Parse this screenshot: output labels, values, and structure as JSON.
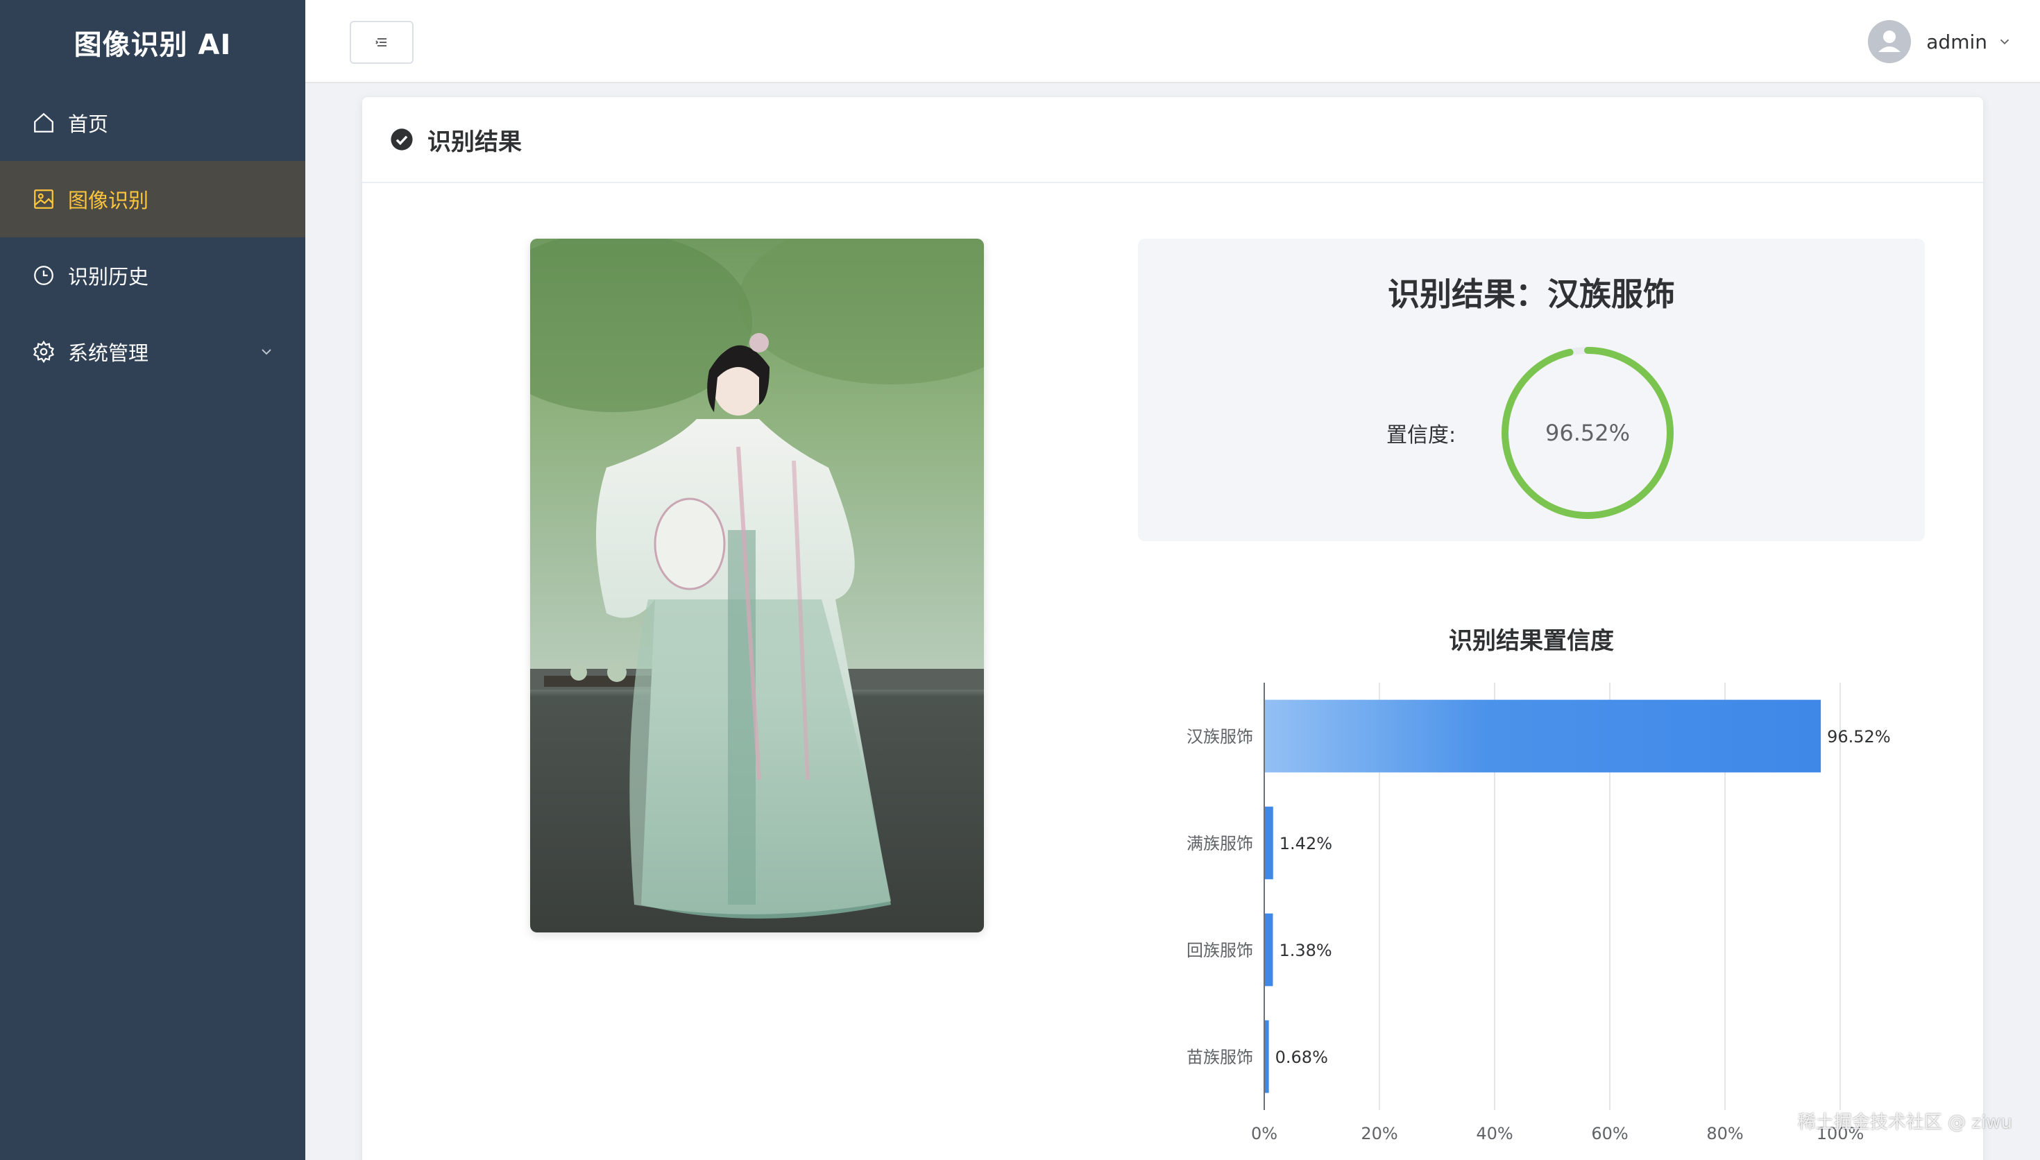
{
  "app": {
    "title": "图像识别 AI"
  },
  "sidebar": {
    "items": [
      {
        "label": "首页",
        "icon": "home-icon",
        "active": false
      },
      {
        "label": "图像识别",
        "icon": "picture-icon",
        "active": true
      },
      {
        "label": "识别历史",
        "icon": "clock-icon",
        "active": false
      },
      {
        "label": "系统管理",
        "icon": "gear-icon",
        "active": false,
        "expandable": true
      }
    ],
    "colors": {
      "background": "#304156",
      "active_background": "#4b4a44",
      "active_text": "#ffc53d"
    }
  },
  "header": {
    "toggle_icon": "menu-fold-icon",
    "user": {
      "name": "admin",
      "avatar_icon": "user-avatar-icon"
    }
  },
  "card": {
    "title": "识别结果",
    "title_icon": "check-circle-icon"
  },
  "image": {
    "alt": "hanfu photo"
  },
  "result": {
    "title": "识别结果：汉族服饰",
    "confidence_label": "置信度:",
    "confidence_text": "96.52%",
    "confidence_value": 96.52,
    "gauge_color": "#7ac44f"
  },
  "chart_title": "识别结果置信度",
  "chart_data": {
    "type": "bar",
    "orientation": "horizontal",
    "title": "识别结果置信度",
    "categories": [
      "汉族服饰",
      "满族服饰",
      "回族服饰",
      "苗族服饰"
    ],
    "values": [
      96.52,
      1.42,
      1.38,
      0.68
    ],
    "value_labels": [
      "96.52%",
      "1.42%",
      "1.38%",
      "0.68%"
    ],
    "xlim": [
      0,
      100
    ],
    "x_ticks": [
      "0%",
      "20%",
      "40%",
      "60%",
      "80%",
      "100%"
    ],
    "grid": true,
    "bar_color": "#3f88e8"
  },
  "watermark": "稀土掘金技术社区 @ ziwu"
}
